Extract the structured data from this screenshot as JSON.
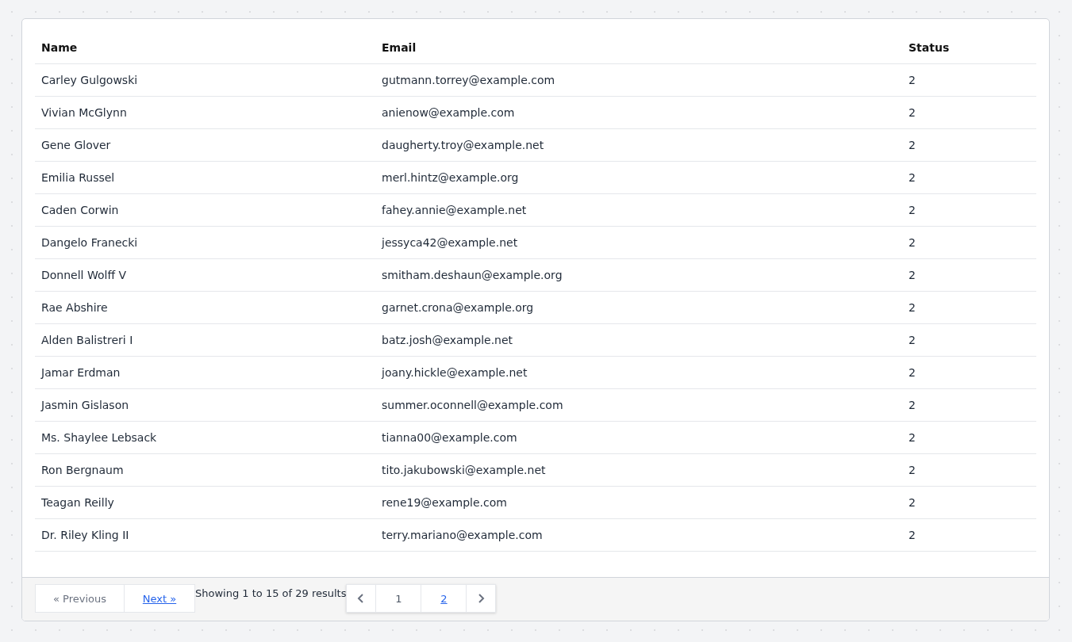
{
  "table": {
    "columns": [
      "Name",
      "Email",
      "Status"
    ],
    "rows": [
      [
        "Carley Gulgowski",
        "gutmann.torrey@example.com",
        "2"
      ],
      [
        "Vivian McGlynn",
        "anienow@example.com",
        "2"
      ],
      [
        "Gene Glover",
        "daugherty.troy@example.net",
        "2"
      ],
      [
        "Emilia Russel",
        "merl.hintz@example.org",
        "2"
      ],
      [
        "Caden Corwin",
        "fahey.annie@example.net",
        "2"
      ],
      [
        "Dangelo Franecki",
        "jessyca42@example.net",
        "2"
      ],
      [
        "Donnell Wolff V",
        "smitham.deshaun@example.org",
        "2"
      ],
      [
        "Rae Abshire",
        "garnet.crona@example.org",
        "2"
      ],
      [
        "Alden Balistreri I",
        "batz.josh@example.net",
        "2"
      ],
      [
        "Jamar Erdman",
        "joany.hickle@example.net",
        "2"
      ],
      [
        "Jasmin Gislason",
        "summer.oconnell@example.com",
        "2"
      ],
      [
        "Ms. Shaylee Lebsack",
        "tianna00@example.com",
        "2"
      ],
      [
        "Ron Bergnaum",
        "tito.jakubowski@example.net",
        "2"
      ],
      [
        "Teagan Reilly",
        "rene19@example.com",
        "2"
      ],
      [
        "Dr. Riley Kling II",
        "terry.mariano@example.com",
        "2"
      ]
    ]
  },
  "pagination": {
    "simple": [
      {
        "label": "« Previous",
        "disabled": true
      },
      {
        "label": "Next »",
        "disabled": false
      }
    ],
    "summary": "Showing 1 to 15 of 29 results",
    "pages": [
      {
        "label": "1",
        "selected": true
      },
      {
        "label": "2",
        "selected": false
      }
    ],
    "prev_disabled": false,
    "next_disabled": false
  }
}
